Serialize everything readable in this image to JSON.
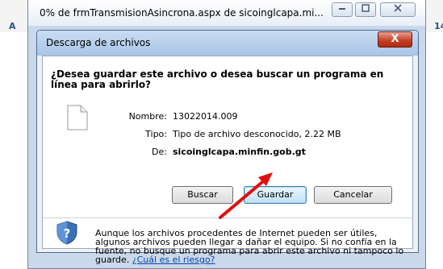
{
  "background": {
    "left_fragment": "A",
    "right_fragment": "14"
  },
  "outer_window": {
    "title": "0% de frmTransmisionAsincrona.aspx de sicoinglcapa.mi..."
  },
  "dialog": {
    "title": "Descarga de archivos",
    "close_symbol": "X",
    "question": "¿Desea guardar este archivo o desea buscar un programa en línea para abrirlo?",
    "fields": {
      "name_label": "Nombre:",
      "name_value": "13022014.009",
      "type_label": "Tipo:",
      "type_value": "Tipo de archivo desconocido, 2.22 MB",
      "from_label": "De:",
      "from_value": "sicoinglcapa.minfin.gob.gt"
    },
    "buttons": {
      "search": "Buscar",
      "save": "Guardar",
      "cancel": "Cancelar"
    },
    "warning": {
      "text": "Aunque los archivos procedentes de Internet pueden ser útiles, algunos archivos pueden llegar a dañar el equipo. Si no confía en la fuente, no busque un programa para abrir este archivo ni tampoco lo guarde.",
      "link": "¿Cuál es el riesgo?"
    }
  },
  "icons": {
    "file": "file-icon",
    "shield": "shield-warning-icon",
    "arrow": "red-arrow-annotation"
  },
  "colors": {
    "arrow": "#e01010",
    "link": "#0645ad",
    "close_button": "#c23d22"
  }
}
